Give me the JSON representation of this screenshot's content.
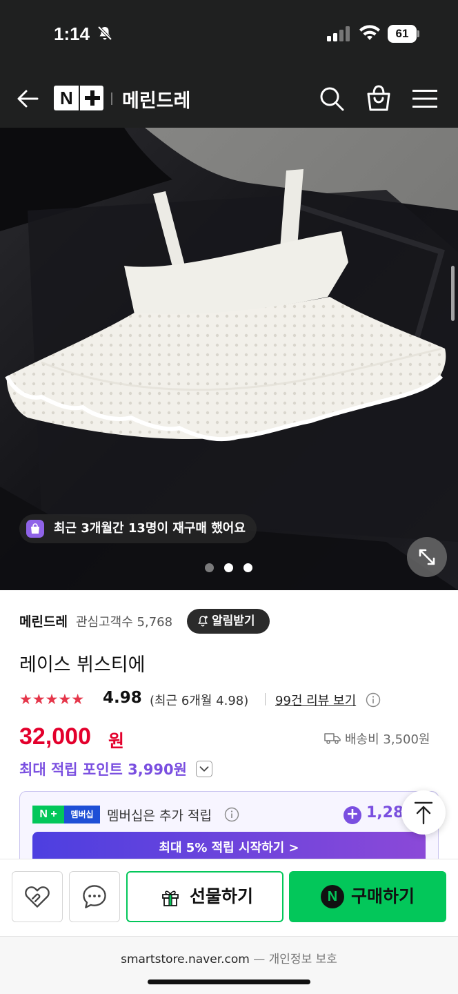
{
  "status_bar": {
    "time": "1:14",
    "battery": "61"
  },
  "header": {
    "brand_logo_text": "N",
    "store_name": "메린드레"
  },
  "product_image": {
    "repurchase_badge": "최근 3개월간 13명이 재구매 했어요",
    "slide_count": 3,
    "active_slide": 1
  },
  "store": {
    "name": "메린드레",
    "follower_label": "관심고객수 5,768",
    "notify_label": "알림받기"
  },
  "product": {
    "title": "레이스 뷔스티에",
    "stars": "★★★★★",
    "rating": "4.98",
    "recent_rating": "(최근 6개월 4.98)",
    "review_link": "99건 리뷰 보기",
    "price": "32,000",
    "price_unit": "원",
    "shipping": "배송비 3,500원",
    "points": "최대 적립 포인트 3,990원"
  },
  "membership": {
    "logo_n": "N +",
    "logo_tag": "멤버십",
    "text": "멤버십은 추가 적립",
    "plus": "+",
    "points": "1,28",
    "cta": "최대 5% 적립 시작하기 >"
  },
  "bottom_bar": {
    "gift_label": "선물하기",
    "buy_label": "구매하기",
    "npay_letter": "N"
  },
  "footer": {
    "domain": "smartstore.naver.com",
    "privacy": " — 개인정보 보호"
  },
  "colors": {
    "header_bg": "#1f2020",
    "price_red": "#e3002c",
    "points_purple": "#7a4fe0",
    "naver_green": "#03c75a",
    "star_red": "#e5364a"
  },
  "icons": {
    "back": "arrow-left-icon",
    "search": "search-icon",
    "cart": "shopping-bag-icon",
    "menu": "hamburger-menu-icon",
    "expand": "expand-arrows-icon",
    "scroll_top": "arrow-up-icon",
    "wish": "heart-icon",
    "talk": "chat-bubble-icon",
    "gift": "gift-icon"
  }
}
